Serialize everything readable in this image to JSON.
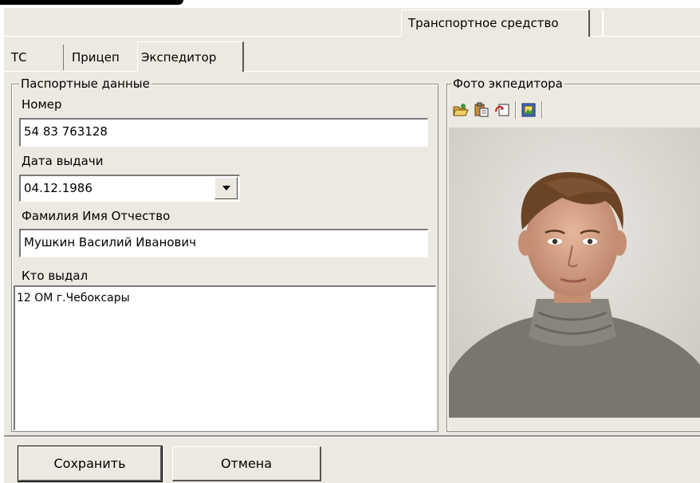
{
  "main_tabs": {
    "active": "Транспортное средство"
  },
  "inner_tabs": [
    {
      "label": "ТС"
    },
    {
      "label": "Прицеп"
    },
    {
      "label": "Экспедитор"
    }
  ],
  "passport": {
    "legend": "Паспортные данные",
    "number_label": "Номер",
    "number_value": "54 83 763128",
    "issue_date_label": "Дата выдачи",
    "issue_date_value": "04.12.1986",
    "fullname_label": "Фамилия Имя Отчество",
    "fullname_value": "Мушкин Василий Иванович",
    "issued_by_label": "Кто выдал",
    "issued_by_value": "12 ОМ г.Чебоксары"
  },
  "photo": {
    "legend": "Фото экпедитора",
    "toolbar_icons": [
      "open-folder-icon",
      "paste-icon",
      "capture-icon",
      "image-properties-icon"
    ]
  },
  "buttons": {
    "save": "Сохранить",
    "cancel": "Отмена"
  },
  "colors": {
    "panel": "#ebe9e1",
    "field": "#ffffff",
    "border": "#8f8f8f"
  }
}
